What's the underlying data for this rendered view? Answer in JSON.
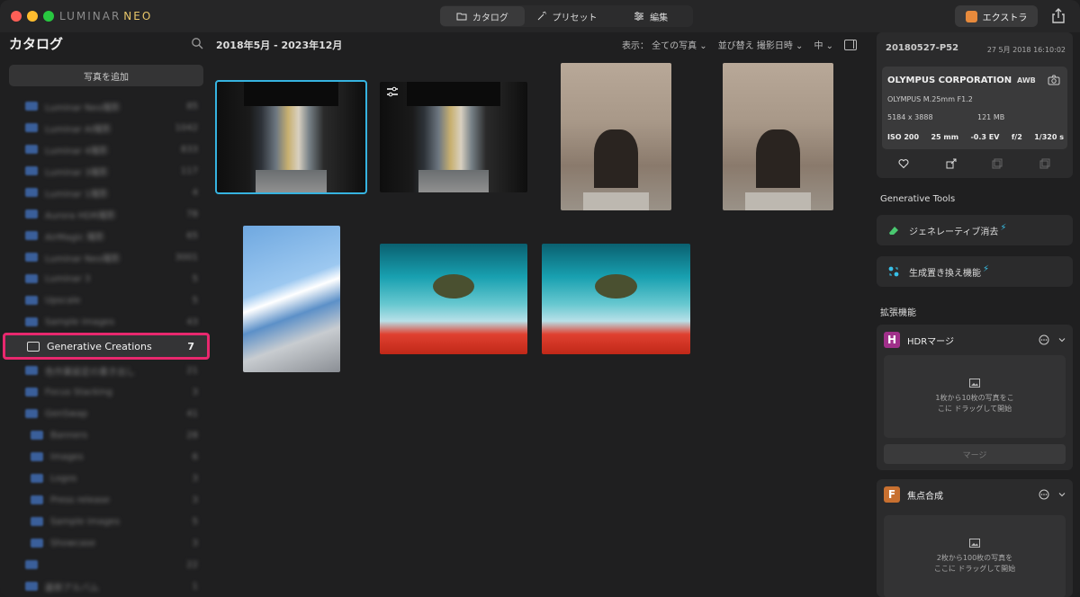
{
  "app": {
    "logo_main": "LUMINAR",
    "logo_accent": "NEO"
  },
  "modes": [
    {
      "label": "カタログ",
      "icon": "folder-icon",
      "active": true
    },
    {
      "label": "プリセット",
      "icon": "magic-wand-icon",
      "active": false
    },
    {
      "label": "編集",
      "icon": "sliders-icon",
      "active": false
    }
  ],
  "header": {
    "extra_label": "エクストラ"
  },
  "sidebar": {
    "title": "カタログ",
    "add_photo": "写真を追加",
    "albums": [
      {
        "name": "Luminar Neo撮影",
        "count": "85"
      },
      {
        "name": "Luminar AI撮影",
        "count": "1042"
      },
      {
        "name": "Luminar 4撮影",
        "count": "833"
      },
      {
        "name": "Luminar 3撮影",
        "count": "117"
      },
      {
        "name": "Luminar 1撮影",
        "count": "4"
      },
      {
        "name": "Aurora HDR撮影",
        "count": "78"
      },
      {
        "name": "AirMagic 撮影",
        "count": "65"
      },
      {
        "name": "Luminar Neo撮影",
        "count": "3001"
      },
      {
        "name": "Luminar 3",
        "count": "5"
      },
      {
        "name": "Upscale",
        "count": "5"
      },
      {
        "name": "Sample images",
        "count": "43"
      },
      {
        "name": "Generative Creations",
        "count": "7",
        "selected": true
      },
      {
        "name": "色作業設定の書き出し",
        "count": "21"
      },
      {
        "name": "Focus Stacking",
        "count": "3"
      },
      {
        "name": "GenSwap",
        "count": "41"
      },
      {
        "name": "Banners",
        "count": "28"
      },
      {
        "name": "Images",
        "count": "6"
      },
      {
        "name": "Logos",
        "count": "3"
      },
      {
        "name": "Press release",
        "count": "3"
      },
      {
        "name": "Sample images",
        "count": "5"
      },
      {
        "name": "Showcase",
        "count": "3"
      },
      {
        "name": "",
        "count": "22"
      },
      {
        "name": "最新アルバム",
        "count": "1"
      }
    ]
  },
  "main": {
    "date_range": "2018年5月 - 2023年12月",
    "view_label": "表示： 全ての写真",
    "sort_label": "並び替え 撮影日時",
    "size_label": "中"
  },
  "info": {
    "filename": "20180527-P52",
    "date": "27 5月 2018 16:10:02",
    "camera": "OLYMPUS CORPORATION",
    "awb": "AWB",
    "lens": "OLYMPUS M.25mm F1.2",
    "resolution": "5184 x 3888",
    "filesize": "121 MB",
    "iso": "ISO 200",
    "focal": "25 mm",
    "ev": "-0.3 EV",
    "aperture": "f/2",
    "shutter": "1/320 s"
  },
  "generative": {
    "title": "Generative Tools",
    "erase": "ジェネレーティブ消去",
    "swap": "生成置き換え機能"
  },
  "extensions": {
    "title": "拡張機能",
    "hdr": {
      "letter": "H",
      "name": "HDRマージ",
      "drop_line1": "1枚から10枚の写真をこ",
      "drop_line2": "こに ドラッグして開始",
      "button": "マージ",
      "color": "#a0308a"
    },
    "focus": {
      "letter": "F",
      "name": "焦点合成",
      "drop_line1": "2枚から100枚の写真を",
      "drop_line2": "ここに ドラッグして開始",
      "color": "#c87030"
    }
  }
}
